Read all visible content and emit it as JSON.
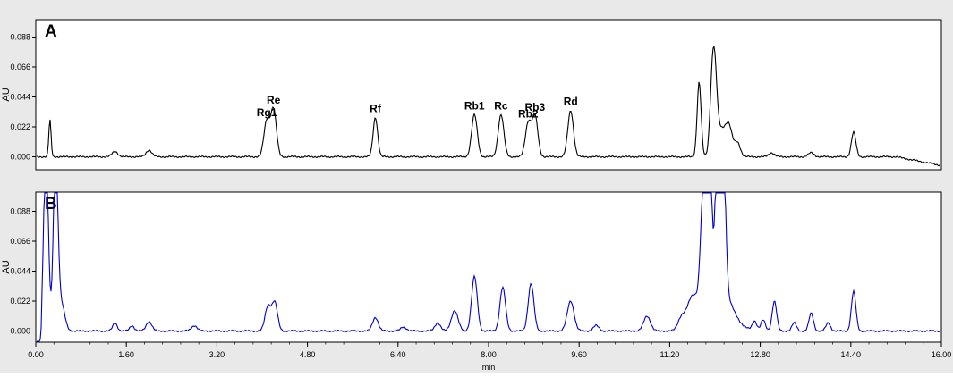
{
  "chart_data": [
    {
      "type": "line",
      "panel_label": "A",
      "ylabel": "AU",
      "y_ticks": [
        "0.000",
        "0.022",
        "0.044",
        "0.066",
        "0.088"
      ],
      "ylim": [
        -0.015,
        0.1
      ],
      "xlim": [
        0,
        16
      ],
      "color": "#000000",
      "series": [
        {
          "baseline": 0.0,
          "peaks": [
            {
              "x": 0.25,
              "y": 0.027,
              "w": 0.02
            },
            {
              "x": 1.4,
              "y": 0.004,
              "w": 0.05
            },
            {
              "x": 2.0,
              "y": 0.005,
              "w": 0.05
            },
            {
              "x": 4.08,
              "y": 0.026,
              "w": 0.05,
              "label": "Rg1"
            },
            {
              "x": 4.2,
              "y": 0.035,
              "w": 0.05,
              "label": "Re"
            },
            {
              "x": 6.0,
              "y": 0.029,
              "w": 0.04,
              "label": "Rf"
            },
            {
              "x": 7.75,
              "y": 0.031,
              "w": 0.05,
              "label": "Rb1"
            },
            {
              "x": 8.22,
              "y": 0.031,
              "w": 0.05,
              "label": "Rc"
            },
            {
              "x": 8.7,
              "y": 0.025,
              "w": 0.05,
              "label": "Rb2"
            },
            {
              "x": 8.82,
              "y": 0.03,
              "w": 0.05,
              "label": "Rb3"
            },
            {
              "x": 9.45,
              "y": 0.034,
              "w": 0.05,
              "label": "Rd"
            },
            {
              "x": 11.72,
              "y": 0.055,
              "w": 0.035
            },
            {
              "x": 11.95,
              "y": 0.045,
              "w": 0.04
            },
            {
              "x": 12.0,
              "y": 0.043,
              "w": 0.04
            },
            {
              "x": 12.1,
              "y": 0.02,
              "w": 0.1
            },
            {
              "x": 12.25,
              "y": 0.018,
              "w": 0.06
            },
            {
              "x": 12.4,
              "y": 0.01,
              "w": 0.05
            },
            {
              "x": 13.0,
              "y": 0.003,
              "w": 0.05
            },
            {
              "x": 13.7,
              "y": 0.003,
              "w": 0.05
            },
            {
              "x": 14.45,
              "y": 0.018,
              "w": 0.04
            }
          ]
        }
      ]
    },
    {
      "type": "line",
      "panel_label": "B",
      "ylabel": "AU",
      "y_ticks": [
        "0.000",
        "0.022",
        "0.044",
        "0.066",
        "0.088"
      ],
      "ylim": [
        -0.015,
        0.1
      ],
      "xlim": [
        0,
        16
      ],
      "color": "#0000cc",
      "series": [
        {
          "baseline": 0.0,
          "peaks": [
            {
              "x": 0.18,
              "y": 0.14,
              "w": 0.04
            },
            {
              "x": 0.35,
              "y": 0.13,
              "w": 0.04
            },
            {
              "x": 0.45,
              "y": 0.02,
              "w": 0.06
            },
            {
              "x": 1.4,
              "y": 0.006,
              "w": 0.04
            },
            {
              "x": 1.7,
              "y": 0.004,
              "w": 0.04
            },
            {
              "x": 2.0,
              "y": 0.007,
              "w": 0.05
            },
            {
              "x": 2.8,
              "y": 0.004,
              "w": 0.05
            },
            {
              "x": 4.1,
              "y": 0.018,
              "w": 0.05
            },
            {
              "x": 4.22,
              "y": 0.021,
              "w": 0.05
            },
            {
              "x": 6.0,
              "y": 0.01,
              "w": 0.05
            },
            {
              "x": 6.5,
              "y": 0.003,
              "w": 0.05
            },
            {
              "x": 7.1,
              "y": 0.006,
              "w": 0.05
            },
            {
              "x": 7.4,
              "y": 0.015,
              "w": 0.06
            },
            {
              "x": 7.75,
              "y": 0.04,
              "w": 0.05
            },
            {
              "x": 8.25,
              "y": 0.032,
              "w": 0.05
            },
            {
              "x": 8.75,
              "y": 0.035,
              "w": 0.05
            },
            {
              "x": 9.45,
              "y": 0.022,
              "w": 0.06
            },
            {
              "x": 9.9,
              "y": 0.004,
              "w": 0.05
            },
            {
              "x": 10.8,
              "y": 0.011,
              "w": 0.06
            },
            {
              "x": 11.4,
              "y": 0.008,
              "w": 0.06
            },
            {
              "x": 11.6,
              "y": 0.022,
              "w": 0.1
            },
            {
              "x": 11.8,
              "y": 0.09,
              "w": 0.05
            },
            {
              "x": 11.9,
              "y": 0.12,
              "w": 0.04
            },
            {
              "x": 12.05,
              "y": 0.12,
              "w": 0.04
            },
            {
              "x": 12.15,
              "y": 0.1,
              "w": 0.04
            },
            {
              "x": 12.05,
              "y": 0.035,
              "w": 0.22
            },
            {
              "x": 12.7,
              "y": 0.007,
              "w": 0.04
            },
            {
              "x": 12.85,
              "y": 0.008,
              "w": 0.04
            },
            {
              "x": 13.05,
              "y": 0.022,
              "w": 0.04
            },
            {
              "x": 13.4,
              "y": 0.006,
              "w": 0.04
            },
            {
              "x": 13.7,
              "y": 0.013,
              "w": 0.04
            },
            {
              "x": 14.0,
              "y": 0.006,
              "w": 0.04
            },
            {
              "x": 14.45,
              "y": 0.029,
              "w": 0.04
            }
          ]
        }
      ]
    }
  ],
  "x_axis": {
    "tick_labels": [
      "0.00",
      "1.60",
      "3.20",
      "4.80",
      "6.40",
      "8.00",
      "9.60",
      "11.20",
      "12.80",
      "14.40",
      "16.00"
    ],
    "xlabel": "min"
  }
}
